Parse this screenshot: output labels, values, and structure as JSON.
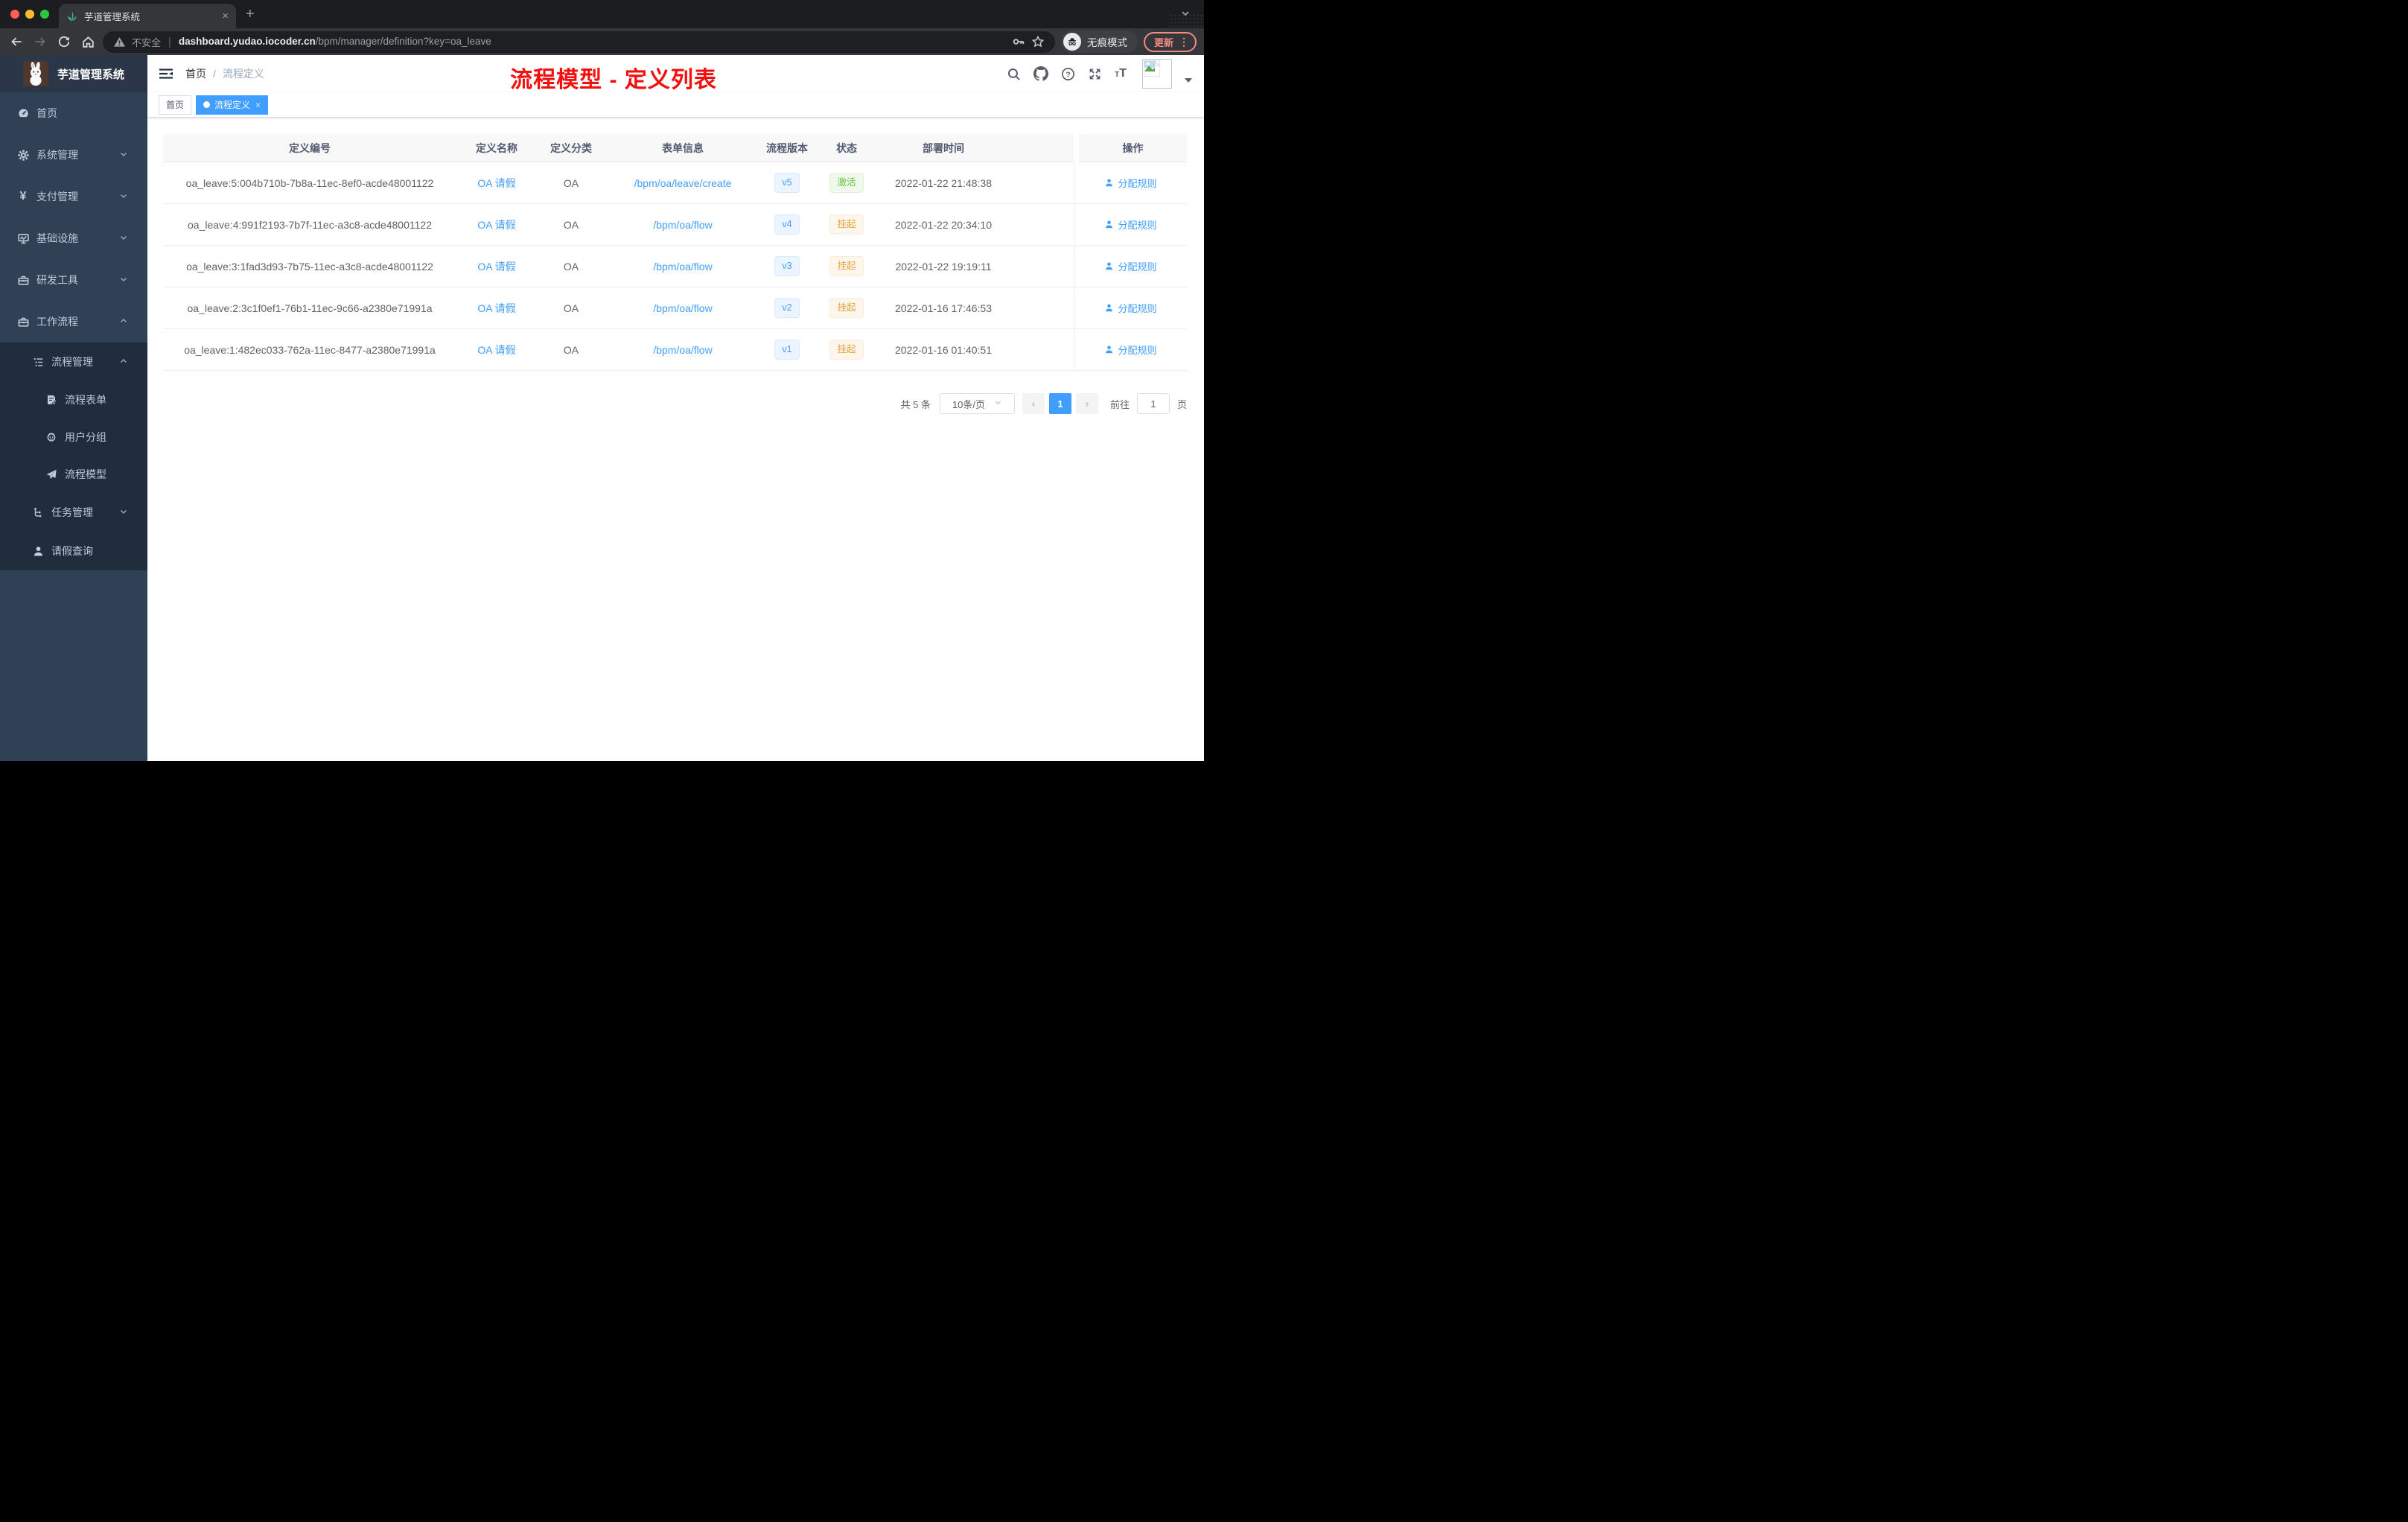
{
  "glyphs": {
    "close": "×",
    "plus": "+",
    "prev": "‹",
    "next": "›",
    "kebab": "⋮",
    "yen": "¥",
    "question": "?",
    "dot_separator": "|",
    "breadcrumb_slash": "/",
    "t_small": "T",
    "t_big": "T"
  },
  "browser": {
    "tab_title": "芋道管理系统",
    "security_label": "不安全",
    "url_host": "dashboard.yudao.iocoder.cn",
    "url_path": "/bpm/manager/definition?key=oa_leave",
    "incognito_label": "无痕模式",
    "update_label": "更新"
  },
  "sidebar": {
    "logo_title": "芋道管理系统",
    "items": [
      {
        "label": "首页"
      },
      {
        "label": "系统管理"
      },
      {
        "label": "支付管理"
      },
      {
        "label": "基础设施"
      },
      {
        "label": "研发工具"
      },
      {
        "label": "工作流程"
      },
      {
        "label": "流程管理"
      },
      {
        "label": "流程表单"
      },
      {
        "label": "用户分组"
      },
      {
        "label": "流程模型"
      },
      {
        "label": "任务管理"
      },
      {
        "label": "请假查询"
      }
    ]
  },
  "topbar": {
    "breadcrumb_home": "首页",
    "breadcrumb_current": "流程定义",
    "annotation": "流程模型 - 定义列表"
  },
  "tags": {
    "home": "首页",
    "active": "流程定义"
  },
  "table": {
    "columns": [
      "定义编号",
      "定义名称",
      "定义分类",
      "表单信息",
      "流程版本",
      "状态",
      "部署时间",
      "操作"
    ],
    "action_label": "分配规则",
    "rows": [
      {
        "id": "oa_leave:5:004b710b-7b8a-11ec-8ef0-acde48001122",
        "name": "OA 请假",
        "category": "OA",
        "form": "/bpm/oa/leave/create",
        "version": "v5",
        "status": "激活",
        "status_class": "badge badge-green",
        "time": "2022-01-22 21:48:38"
      },
      {
        "id": "oa_leave:4:991f2193-7b7f-11ec-a3c8-acde48001122",
        "name": "OA 请假",
        "category": "OA",
        "form": "/bpm/oa/flow",
        "version": "v4",
        "status": "挂起",
        "status_class": "badge badge-yellow",
        "time": "2022-01-22 20:34:10"
      },
      {
        "id": "oa_leave:3:1fad3d93-7b75-11ec-a3c8-acde48001122",
        "name": "OA 请假",
        "category": "OA",
        "form": "/bpm/oa/flow",
        "version": "v3",
        "status": "挂起",
        "status_class": "badge badge-yellow",
        "time": "2022-01-22 19:19:11"
      },
      {
        "id": "oa_leave:2:3c1f0ef1-76b1-11ec-9c66-a2380e71991a",
        "name": "OA 请假",
        "category": "OA",
        "form": "/bpm/oa/flow",
        "version": "v2",
        "status": "挂起",
        "status_class": "badge badge-yellow",
        "time": "2022-01-16 17:46:53"
      },
      {
        "id": "oa_leave:1:482ec033-762a-11ec-8477-a2380e71991a",
        "name": "OA 请假",
        "category": "OA",
        "form": "/bpm/oa/flow",
        "version": "v1",
        "status": "挂起",
        "status_class": "badge badge-yellow",
        "time": "2022-01-16 01:40:51"
      }
    ]
  },
  "pagination": {
    "total": "共 5 条",
    "page_size": "10条/页",
    "page": "1",
    "goto": "前往",
    "goto_value": "1",
    "page_unit": "页"
  },
  "colors": {
    "accent": "#409eff",
    "success": "#67c23a",
    "warning": "#e6a23c",
    "annotation_red": "#f40e0e",
    "sidebar_bg": "#304156",
    "submenu_bg": "#1f2d3d"
  }
}
